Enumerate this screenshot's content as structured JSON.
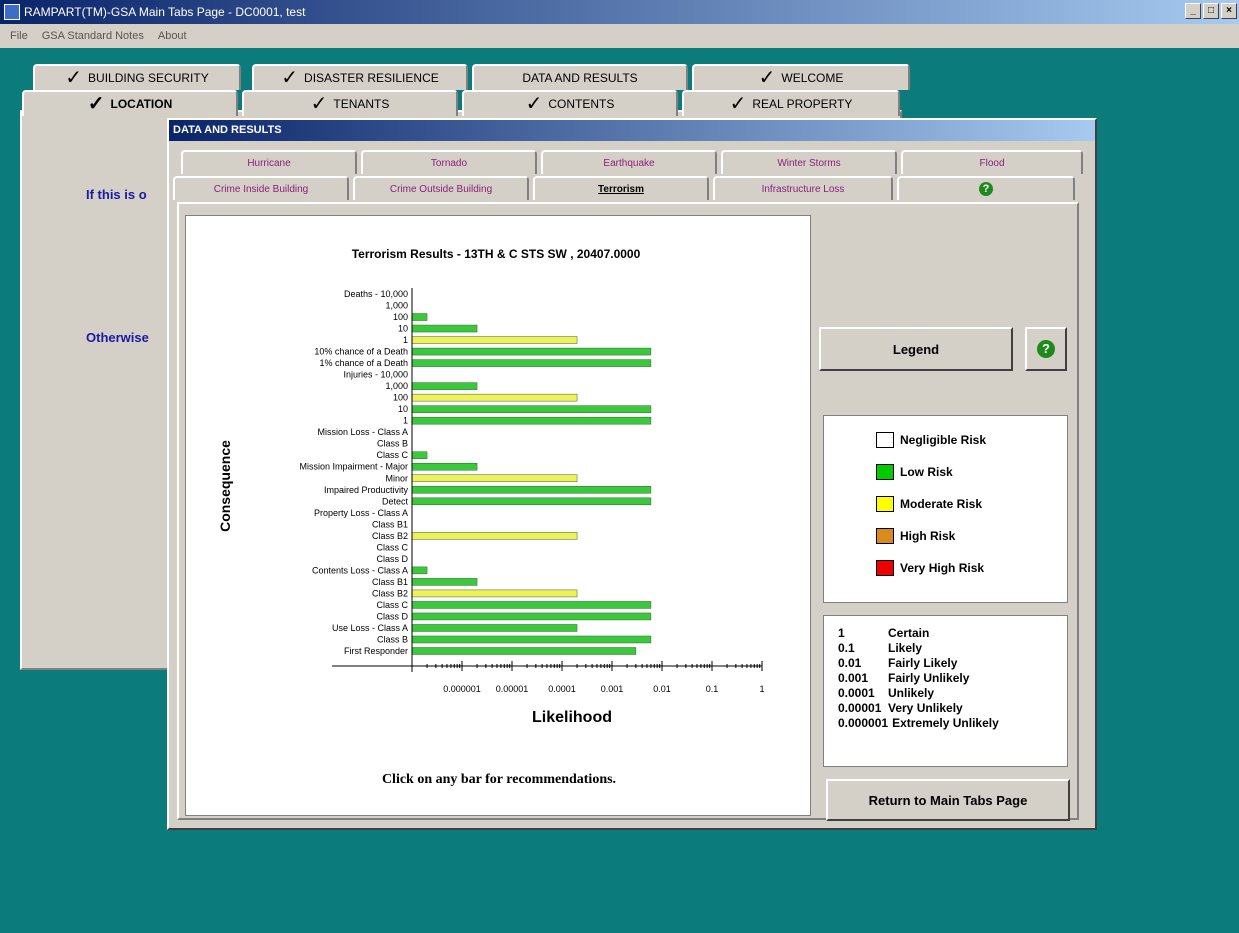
{
  "window": {
    "title": "RAMPART(TM)-GSA Main Tabs Page - DC0001, test"
  },
  "menu": [
    "File",
    "GSA Standard Notes",
    "About"
  ],
  "main_tabs_back": [
    {
      "label": "BUILDING SECURITY",
      "checked": true
    },
    {
      "label": "DISASTER RESILIENCE",
      "checked": true
    },
    {
      "label": "DATA AND RESULTS",
      "checked": false
    },
    {
      "label": "WELCOME",
      "checked": true
    }
  ],
  "main_tabs_front": [
    {
      "label": "LOCATION",
      "checked": true
    },
    {
      "label": "TENANTS",
      "checked": true
    },
    {
      "label": "CONTENTS",
      "checked": true
    },
    {
      "label": "REAL PROPERTY",
      "checked": true
    }
  ],
  "main_text": {
    "line1": "If this is o",
    "line2": "Otherwise"
  },
  "dialog": {
    "title": "DATA AND RESULTS"
  },
  "sub_tabs_back": [
    "Hurricane",
    "Tornado",
    "Earthquake",
    "Winter Storms",
    "Flood"
  ],
  "sub_tabs_front": [
    "Crime Inside Building",
    "Crime Outside Building",
    "Terrorism",
    "Infrastructure Loss"
  ],
  "footer_note": "Click on any bar for recommendations.",
  "legend_button": "Legend",
  "return_button": "Return to Main Tabs Page",
  "legend": [
    {
      "label": "Negligible Risk",
      "color": "#ffffff"
    },
    {
      "label": "Low Risk",
      "color": "#00cc00"
    },
    {
      "label": "Moderate Risk",
      "color": "#ffff00"
    },
    {
      "label": "High Risk",
      "color": "#d88a1c"
    },
    {
      "label": "Very High Risk",
      "color": "#ee0000"
    }
  ],
  "likelihood_scale": [
    {
      "value": "1",
      "label": "Certain"
    },
    {
      "value": "0.1",
      "label": "Likely"
    },
    {
      "value": "0.01",
      "label": "Fairly Likely"
    },
    {
      "value": "0.001",
      "label": "Fairly Unlikely"
    },
    {
      "value": "0.0001",
      "label": "Unlikely"
    },
    {
      "value": "0.00001",
      "label": "Very Unlikely"
    },
    {
      "value": "0.000001",
      "label": "Extremely Unlikely"
    }
  ],
  "chart_data": {
    "type": "bar",
    "orientation": "horizontal",
    "title": "Terrorism Results - 13TH & C STS SW , 20407.0000",
    "xlabel": "Likelihood",
    "ylabel": "Consequence",
    "x_scale": "log",
    "xlim": [
      1e-07,
      1
    ],
    "x_ticks": [
      "0.000001",
      "0.00001",
      "0.0001",
      "0.001",
      "0.01",
      "0.1",
      "1"
    ],
    "colors": {
      "low": "#3cc83c",
      "moderate": "#f0f05a"
    },
    "categories": [
      "Deaths - 10,000",
      "1,000",
      "100",
      "10",
      "1",
      "10% chance of a Death",
      "1% chance of a Death",
      "Injuries - 10,000",
      "1,000",
      "100",
      "10",
      "1",
      "Mission Loss - Class A",
      "Class B",
      "Class C",
      "Mission Impairment - Major",
      "Minor",
      "Impaired Productivity",
      "Detect",
      "Property Loss - Class A",
      "Class B1",
      "Class B2",
      "Class C",
      "Class D",
      "Contents Loss - Class A",
      "Class B1",
      "Class B2",
      "Class C",
      "Class D",
      "Use Loss - Class A",
      "Class B",
      "First Responder"
    ],
    "values": [
      null,
      null,
      2e-07,
      2e-06,
      0.0002,
      0.006,
      0.006,
      null,
      2e-06,
      0.0002,
      0.006,
      0.006,
      null,
      null,
      2e-07,
      2e-06,
      0.0002,
      0.006,
      0.006,
      null,
      null,
      0.0002,
      null,
      null,
      2e-07,
      2e-06,
      0.0002,
      0.006,
      0.006,
      0.0002,
      0.006,
      0.003
    ],
    "risk": [
      null,
      null,
      "low",
      "low",
      "moderate",
      "low",
      "low",
      null,
      "low",
      "moderate",
      "low",
      "low",
      null,
      null,
      "low",
      "low",
      "moderate",
      "low",
      "low",
      null,
      null,
      "moderate",
      null,
      null,
      "low",
      "low",
      "moderate",
      "low",
      "low",
      "low",
      "low",
      "low"
    ]
  }
}
